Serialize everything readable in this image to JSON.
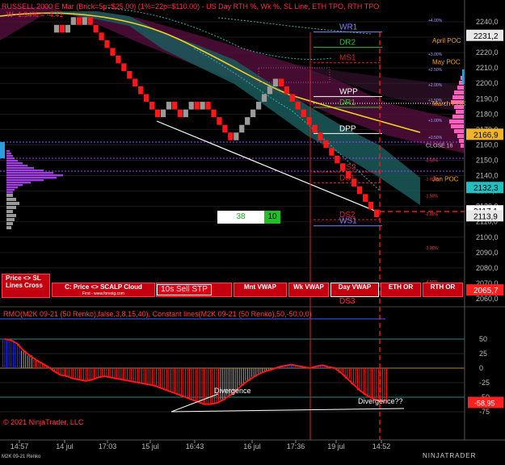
{
  "header": {
    "main_title": "RUSSELL 2000 E Mar (Brick=5p=$25.00) (1%=22p=$110.00) - US Day RTH %, Wk %, SL Line, ETH TPO, RTH TPO",
    "sub_title": "W -1.94% = -4.41"
  },
  "x_axis": {
    "labels": [
      "14:57",
      "14 jul",
      "17:03",
      "15 jul",
      "16:43",
      "16 jul",
      "17:36",
      "19 jul",
      "14:52"
    ]
  },
  "price_axis": {
    "ticks": [
      "2240,0",
      "2230,0",
      "2220,0",
      "2210,0",
      "2200,0",
      "2190,0",
      "2180,0",
      "2170,0",
      "2160,0",
      "2150,0",
      "2140,0",
      "2130,0",
      "2120,0",
      "2110,0",
      "2100,0",
      "2090,0",
      "2080,0",
      "2070,0",
      "2060,0"
    ]
  },
  "price_markers": [
    {
      "text": "2231,2",
      "color": "#e8e8e8",
      "text_color": "#000000",
      "value": 2231.2
    },
    {
      "text": "2166,9",
      "color": "#f0b428",
      "text_color": "#000000",
      "value": 2166.9
    },
    {
      "text": "2132,3",
      "color": "#20c0c0",
      "text_color": "#000000",
      "value": 2132.3
    },
    {
      "text": "2117,1",
      "color": "#ffffff",
      "text_color": "#000000",
      "value": 2117.1
    },
    {
      "text": "2113,9",
      "color": "#e8e8e8",
      "text_color": "#000000",
      "value": 2113.9
    },
    {
      "text": "2065,7",
      "color": "#ff2020",
      "text_color": "#ffffff",
      "value": 2065.7
    }
  ],
  "pivot_labels": [
    {
      "text": "WR1",
      "color": "#8080ff",
      "value": 2236
    },
    {
      "text": "DR2",
      "color": "#30c030",
      "value": 2226
    },
    {
      "text": "MS1",
      "color": "#e02020",
      "value": 2216
    },
    {
      "text": "WPP",
      "color": "#ffffff",
      "value": 2194
    },
    {
      "text": "DR1",
      "color": "#30c030",
      "value": 2187
    },
    {
      "text": "DPP",
      "color": "#ffffff",
      "value": 2170
    },
    {
      "text": "MS2",
      "color": "#e02020",
      "value": 2145
    },
    {
      "text": "DS1",
      "color": "#e02020",
      "value": 2138
    },
    {
      "text": "DS2",
      "color": "#e02020",
      "value": 2114
    },
    {
      "text": "WS1",
      "color": "#8080ff",
      "value": 2110
    }
  ],
  "poc_labels": [
    {
      "text": "April POC",
      "color": "#f0a020",
      "value": 2228
    },
    {
      "text": "May POC",
      "color": "#f0a020",
      "value": 2214
    },
    {
      "text": "March POC",
      "color": "#f0a020",
      "value": 2187
    },
    {
      "text": "CLOSE 16",
      "color": "#c0c0c0",
      "value": 2160
    },
    {
      "text": "Jan POC",
      "color": "#f0a020",
      "value": 2138
    }
  ],
  "percent_labels": [
    {
      "text": "+4.00%",
      "value": 2241
    },
    {
      "text": "+3.00%",
      "value": 2219
    },
    {
      "text": "+2.50%",
      "value": 2209
    },
    {
      "text": "+2.00%",
      "value": 2199
    },
    {
      "text": "+1.50%",
      "value": 2189
    },
    {
      "text": "+1.00%",
      "value": 2176
    },
    {
      "text": "+0.50%",
      "value": 2165
    },
    {
      "text": "-0.50%",
      "value": 2150
    },
    {
      "text": "-1.00%",
      "value": 2138
    },
    {
      "text": "-1.50%",
      "value": 2127
    },
    {
      "text": "-2.00%",
      "value": 2115
    },
    {
      "text": "-3.00%",
      "value": 2093
    },
    {
      "text": "-4.00%",
      "value": 2071
    }
  ],
  "toolbar": {
    "buttons": [
      {
        "line1": "Price <> SL",
        "line2": "Lines Cross"
      },
      {
        "line1": "C: Price <> SCALP Cloud",
        "line2": "First - www.forexig.com"
      },
      {
        "line1": "C",
        "line2": ""
      },
      {
        "line1": "Mnt VWAP",
        "line2": ""
      },
      {
        "line1": "Wk VWAP",
        "line2": ""
      },
      {
        "line1": "Day VWAP",
        "line2": ""
      },
      {
        "line1": "ETH OR",
        "line2": ""
      },
      {
        "line1": "RTH OR",
        "line2": ""
      }
    ],
    "stp_label": "10s Sell STP",
    "ds3_label": "DS3"
  },
  "counter": {
    "left": "38",
    "right": "10"
  },
  "oscillator": {
    "title": "RMO(M2K 09-21 (50 Renko),false,3,8,15,40), Constant lines(M2K 09-21 (50 Renko),50,-50,0,0)",
    "ticks": [
      "50",
      "25",
      "0",
      "-25",
      "-50",
      "-75"
    ],
    "marker": "-58,95",
    "divergence_1": "Divergence",
    "divergence_2": "Divergence??"
  },
  "footer": {
    "copyright": "© 2021 NinjaTrader, LLC",
    "instrument": "M2K 09-21 Renko",
    "logo": "NINJATRADER"
  },
  "chart_data": {
    "type": "bar",
    "title": "RUSSELL 2000 E Mar (Brick=5p=$25.00) Renko",
    "ylim": [
      2055,
      2245
    ],
    "renko_closes": [
      2238,
      2233,
      2238,
      2243,
      2238,
      2243,
      2238,
      2233,
      2228,
      2223,
      2218,
      2213,
      2208,
      2203,
      2198,
      2193,
      2188,
      2183,
      2178,
      2183,
      2188,
      2183,
      2178,
      2183,
      2188,
      2183,
      2188,
      2183,
      2178,
      2173,
      2168,
      2163,
      2168,
      2173,
      2178,
      2183,
      2188,
      2193,
      2198,
      2203,
      2198,
      2193,
      2188,
      2183,
      2178,
      2173,
      2168,
      2163,
      2158,
      2153,
      2148,
      2143,
      2138,
      2133,
      2128,
      2123,
      2118,
      2113
    ],
    "oscillator_ylim": [
      -80,
      60
    ],
    "oscillator_values": [
      50,
      48,
      42,
      30,
      22,
      14,
      8,
      2,
      -6,
      -12,
      -14,
      -18,
      -20,
      -22,
      -20,
      -16,
      -14,
      -16,
      -18,
      -20,
      -22,
      -24,
      -26,
      -28,
      -30,
      -34,
      -38,
      -42,
      -46,
      -50,
      -54,
      -58,
      -62,
      -62,
      -60,
      -55,
      -48,
      -40,
      -30,
      -22,
      -15,
      -9,
      -5,
      -2,
      2,
      4,
      6,
      4,
      2,
      0,
      3,
      5,
      2,
      0,
      -8,
      -18,
      -28,
      -38,
      -46,
      -52,
      -56,
      -58
    ]
  }
}
